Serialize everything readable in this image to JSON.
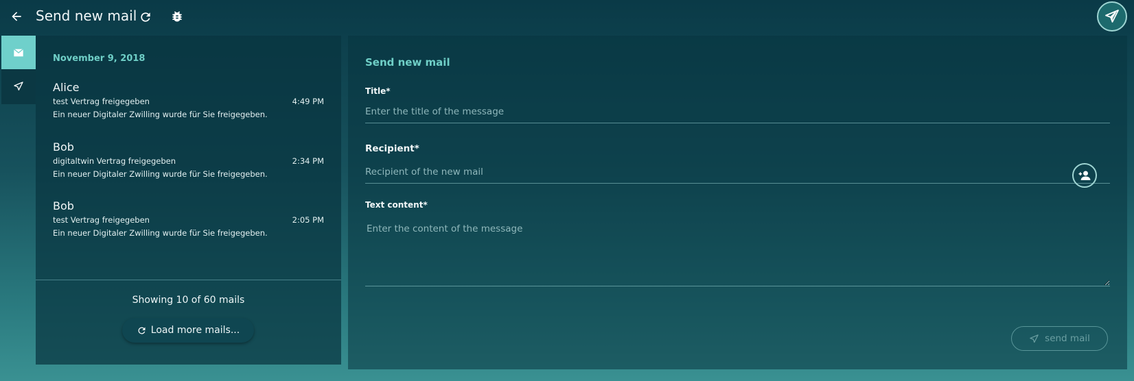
{
  "header": {
    "title": "Send new mail",
    "icons": {
      "back": "arrow-left-icon",
      "refresh": "refresh-icon",
      "debug": "bug-icon",
      "send": "paper-plane-icon"
    }
  },
  "rail": {
    "items": [
      {
        "name": "inbox",
        "icon": "mail-icon",
        "active": true
      },
      {
        "name": "sent",
        "icon": "paper-plane-icon",
        "active": false
      }
    ]
  },
  "mail_list": {
    "date": "November 9, 2018",
    "items": [
      {
        "sender": "Alice",
        "subject": "test Vertrag freigegeben",
        "time": "4:49 PM",
        "preview": "Ein neuer Digitaler Zwilling wurde für Sie freigegeben."
      },
      {
        "sender": "Bob",
        "subject": "digitaltwin Vertrag freigegeben",
        "time": "2:34 PM",
        "preview": "Ein neuer Digitaler Zwilling wurde für Sie freigegeben."
      },
      {
        "sender": "Bob",
        "subject": "test Vertrag freigegeben",
        "time": "2:05 PM",
        "preview": "Ein neuer Digitaler Zwilling wurde für Sie freigegeben."
      }
    ],
    "showing": "Showing 10 of 60 mails",
    "load_more_label": "Load more mails..."
  },
  "compose": {
    "heading": "Send new mail",
    "title_label": "Title*",
    "title_placeholder": "Enter the title of the message",
    "title_value": "",
    "recipient_label": "Recipient*",
    "recipient_placeholder": "Recipient of the new mail",
    "recipient_value": "",
    "content_label": "Text content*",
    "content_placeholder": "Enter the content of the message",
    "content_value": "",
    "send_label": "send mail"
  },
  "colors": {
    "accent": "#6fcfc7",
    "panel": "#0a3a47"
  }
}
